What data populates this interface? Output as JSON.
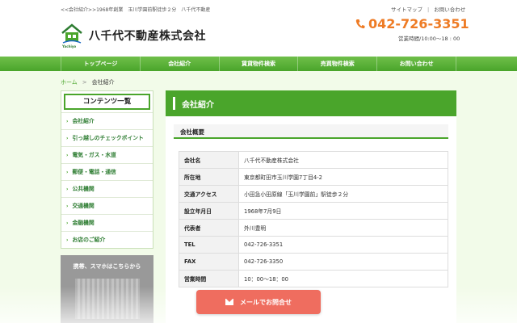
{
  "header": {
    "tagline": "<<会社紹介>>1968年創業　玉川学園前駅徒歩２分　八千代不動産",
    "logo_caption": "Yachiyo",
    "company_name": "八千代不動産株式会社",
    "util_links": [
      "サイトマップ",
      "お問い合わせ"
    ],
    "phone": "042-726-3351",
    "hours": "営業時間/10:00～18 : 00"
  },
  "nav": {
    "items": [
      "トップページ",
      "会社紹介",
      "賃貸物件検索",
      "売買物件検索",
      "お問い合わせ"
    ]
  },
  "breadcrumb": {
    "home": "ホーム",
    "arrow": ">",
    "current": "会社紹介"
  },
  "sidebar": {
    "title": "コンテンツ一覧",
    "items": [
      "会社紹介",
      "引っ越しのチェックポイント",
      "電気・ガス・水道",
      "郵便・電話・通信",
      "公共機関",
      "交通機関",
      "金融機関",
      "お店のご紹介"
    ],
    "mobile_title": "携帯、スマホはこちらから"
  },
  "main": {
    "title": "会社紹介",
    "section": "会社概要",
    "rows": [
      {
        "key": "会社名",
        "value": "八千代不動産株式会社"
      },
      {
        "key": "所在地",
        "value": "東京都町田市玉川学園7丁目4-2"
      },
      {
        "key": "交通アクセス",
        "value": "小田急小田原線「玉川学園前」駅徒歩２分"
      },
      {
        "key": "設立年月日",
        "value": "1968年7月9日"
      },
      {
        "key": "代表者",
        "value": "外川豊明"
      },
      {
        "key": "TEL",
        "value": "042-726-3351"
      },
      {
        "key": "FAX",
        "value": "042-726-3350"
      },
      {
        "key": "営業時間",
        "value": "10：00～18：00"
      }
    ]
  },
  "cta": {
    "mail_label": "メールでお問合せ"
  },
  "colors": {
    "brand_green": "#4aa52b",
    "phone_orange": "#ee7b24",
    "cta_red": "#ef6d5f"
  }
}
